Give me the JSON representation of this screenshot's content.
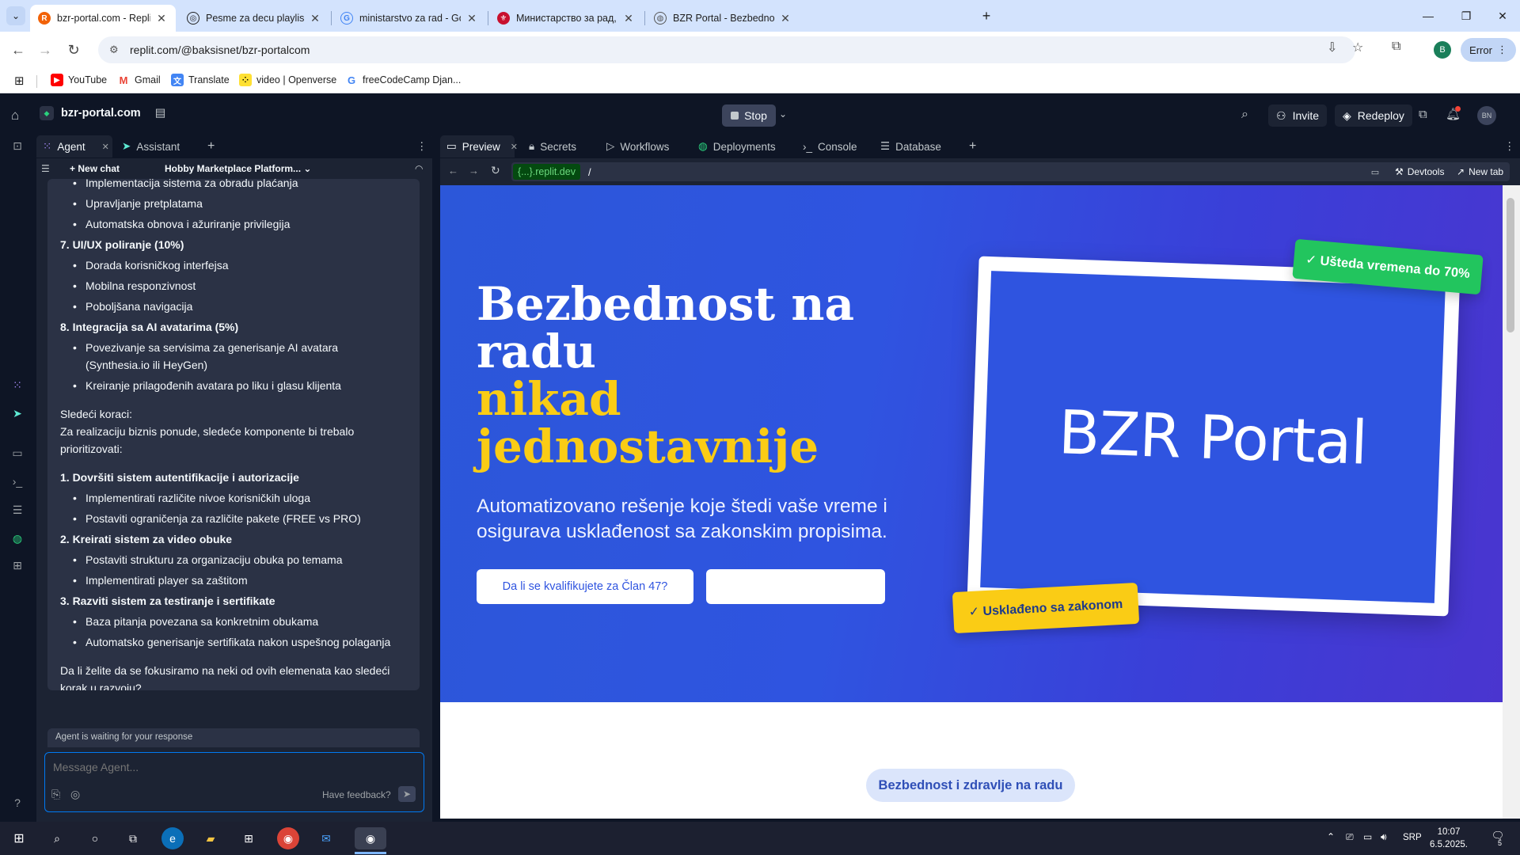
{
  "browser": {
    "tabs": [
      {
        "title": "bzr-portal.com - Replit",
        "favicon": "replit-icon",
        "active": true
      },
      {
        "title": "Pesme za decu playlist",
        "favicon": "openai-icon",
        "active": false
      },
      {
        "title": "ministarstvo za rad - Google Se",
        "favicon": "google-icon",
        "active": false
      },
      {
        "title": "Министарство за рад, запошљ",
        "favicon": "serbia-crest-icon",
        "active": false
      },
      {
        "title": "BZR Portal - Bezbednost i zdrav",
        "favicon": "globe-icon",
        "active": false
      }
    ],
    "url": "replit.com/@baksisnet/bzr-portalcom",
    "profile_initial": "B",
    "error_label": "Error",
    "bookmarks": [
      "YouTube",
      "Gmail",
      "Translate",
      "video | Openverse",
      "freeCodeCamp Djan..."
    ]
  },
  "replit": {
    "repl_name": "bzr-portal.com",
    "stop_label": "Stop",
    "invite_label": "Invite",
    "redeploy_label": "Redeploy",
    "avatar_initials": "BN",
    "agent_tabs": [
      "Agent",
      "Assistant"
    ],
    "new_chat_label": "New chat",
    "chat_title": "Hobby Marketplace Platform...",
    "waiting_text": "Agent is waiting for your response",
    "message_placeholder": "Message Agent...",
    "feedback_label": "Have feedback?",
    "right_tabs": [
      "Preview",
      "Secrets",
      "Workflows",
      "Deployments",
      "Console",
      "Database"
    ],
    "url_dev": "{...}.replit.dev",
    "url_path": "/",
    "devtools_label": "Devtools",
    "newtab_label": "New tab"
  },
  "chat": {
    "cut_line": "Implementacija sistema za obradu plaćanja",
    "b1": "Upravljanje pretplatama",
    "b2": "Automatska obnova i ažuriranje privilegija",
    "h7": "7. UI/UX poliranje (10%)",
    "b3": "Dorada korisničkog interfejsa",
    "b4": "Mobilna responzivnost",
    "b5": "Poboljšana navigacija",
    "h8": "8. Integracija sa AI avatarima (5%)",
    "b6": "Povezivanje sa servisima za generisanje AI avatara (Synthesia.io ili HeyGen)",
    "b7": "Kreiranje prilagođenih avatara po liku i glasu klijenta",
    "next_title": "Sledeći koraci:",
    "next_text": "Za realizaciju biznis ponude, sledeće komponente bi trebalo prioritizovati:",
    "s1": "1. Dovršiti sistem autentifikacije i autorizacije",
    "s1a": "Implementirati različite nivoe korisničkih uloga",
    "s1b": "Postaviti ograničenja za različite pakete (FREE vs PRO)",
    "s2": "2. Kreirati sistem za video obuke",
    "s2a": "Postaviti strukturu za organizaciju obuka po temama",
    "s2b": "Implementirati player sa zaštitom",
    "s3": "3. Razviti sistem za testiranje i sertifikate",
    "s3a": "Baza pitanja povezana sa konkretnim obukama",
    "s3b": "Automatsko generisanje sertifikata nakon uspešnog polaganja",
    "closing": "Da li želite da se fokusiramo na neki od ovih elemenata kao sledeći korak u razvoju?"
  },
  "preview": {
    "h1_line1": "Bezbednost na",
    "h1_line2": "radu",
    "h1_line3": "nikad",
    "h1_line4": "jednostavnije",
    "subtitle": "Automatizovano rešenje koje štedi vaše vreme i osigurava usklađenost sa zakonskim propisima.",
    "btn_primary": "Da li se kvalifikujete za Član 47?",
    "btn_secondary": "",
    "laptop_text": "BZR Portal",
    "badge_green": "✓ Ušteda vremena do 70%",
    "badge_yellow": "✓ Usklađeno sa zakonom",
    "section_pill": "Bezbednost i zdravlje na radu"
  },
  "taskbar": {
    "lang": "SRP",
    "time": "10:07",
    "date": "6.5.2025.",
    "notif_count": "5"
  },
  "colors": {
    "replit_bg": "#0e1525",
    "replit_panel": "#1c2333",
    "hero_blue": "#2f54e0",
    "accent_yellow": "#facc15",
    "accent_green": "#22c55e"
  }
}
